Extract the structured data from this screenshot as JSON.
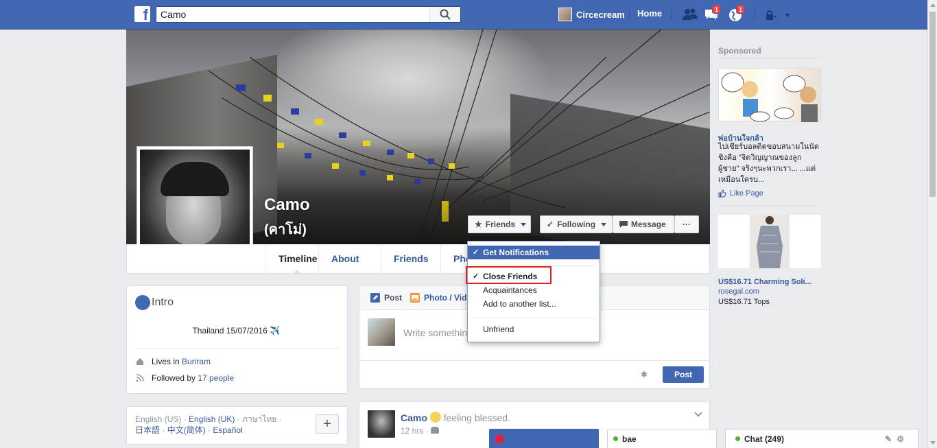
{
  "topbar": {
    "logo": "f",
    "search_value": "Camo",
    "user_name": "Circecream",
    "home_label": "Home",
    "friend_requests_badge": "",
    "messages_badge": "1",
    "notifications_badge": "1"
  },
  "profile": {
    "name": "Camo",
    "alt_name": "(คาโม่)",
    "buttons": {
      "friends": "Friends",
      "following": "Following",
      "message": "Message",
      "more": "···"
    },
    "tabs": [
      "Timeline",
      "About",
      "Friends",
      "Pho"
    ]
  },
  "dropdown": {
    "items": [
      {
        "label": "Get Notifications",
        "checked": true,
        "selected": true
      },
      {
        "label": "Close Friends",
        "checked": true,
        "selected": false
      },
      {
        "label": "Acquaintances",
        "checked": false,
        "selected": false
      },
      {
        "label": "Add to another list...",
        "checked": false,
        "selected": false
      },
      {
        "label": "Unfriend",
        "checked": false,
        "selected": false
      }
    ]
  },
  "intro": {
    "title": "Intro",
    "bio": "Thailand 15/07/2016 ✈️ ",
    "lives_prefix": "Lives in ",
    "lives_place": "Buriram",
    "followed_prefix": "Followed by ",
    "followed_count": "17 people"
  },
  "languages": {
    "line1": [
      "English (US)",
      "English (UK)",
      "ภาษาไทย"
    ],
    "line2": [
      "日本語",
      "中文(简体)",
      "Español"
    ],
    "add": "+"
  },
  "composer": {
    "tab_post": "Post",
    "tab_photo": "Photo / Vide",
    "placeholder": "Write somethin",
    "post_button": "Post"
  },
  "post": {
    "author": "Camo",
    "feeling": "feeling blessed.",
    "time": "12 hrs ·"
  },
  "ads": {
    "sponsored": "Sponsored",
    "ad1": {
      "title": "พ่อบ้านใจกล้า",
      "body": "ไปเชียร์บอลติดขอบสนามในนัดชิงคือ \"จิตวิญญาณของลูกผู้ชาย\" จริงๆนะพวกเรา... ...แต่เหมือนใครบ...",
      "like_page": "Like Page"
    },
    "ad2": {
      "title": "US$16.71 Charming Soli...",
      "domain": "rosegal.com",
      "body": "US$16.71 Tops"
    }
  },
  "chat": {
    "tab1": "",
    "tab2": "bae",
    "main": "Chat (249)"
  },
  "colors": {
    "brand": "#4267b2",
    "link": "#365899",
    "highlight_box": "#e02020"
  }
}
